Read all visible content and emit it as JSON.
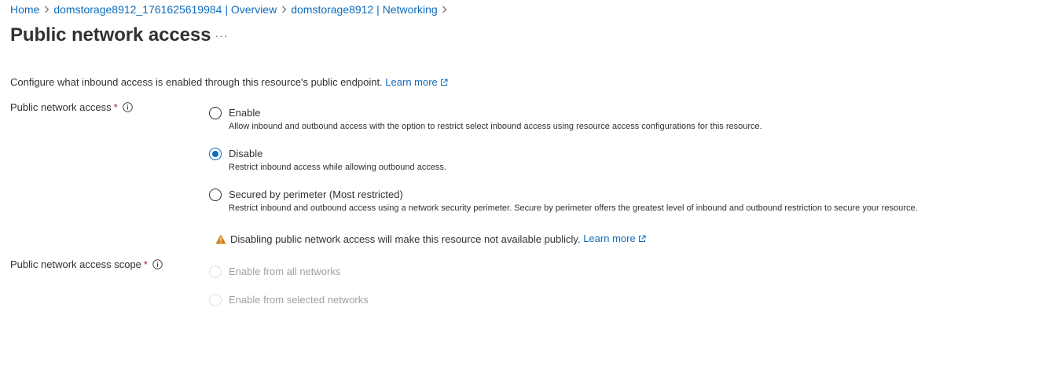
{
  "breadcrumb": {
    "items": [
      "Home",
      "domstorage8912_1761625619984 | Overview",
      "domstorage8912 | Networking"
    ]
  },
  "page": {
    "title": "Public network access",
    "more_label": "···"
  },
  "description": {
    "text": "Configure what inbound access is enabled through this resource's public endpoint.",
    "link": "Learn more"
  },
  "public_network_access": {
    "label": "Public network access",
    "required": "*",
    "options": [
      {
        "label": "Enable",
        "description": "Allow inbound and outbound access with the option to restrict select inbound access using resource access configurations for this resource.",
        "selected": false
      },
      {
        "label": "Disable",
        "description": "Restrict inbound access while allowing outbound access.",
        "selected": true
      },
      {
        "label": "Secured by perimeter (Most restricted)",
        "description": "Restrict inbound and outbound access using a network security perimeter. Secure by perimeter offers the greatest level of inbound and outbound restriction to secure your resource.",
        "selected": false
      }
    ]
  },
  "warning": {
    "text": "Disabling public network access will make this resource not available publicly.",
    "link": "Learn more"
  },
  "scope": {
    "label": "Public network access scope",
    "required": "*",
    "options": [
      {
        "label": "Enable from all networks",
        "disabled": true
      },
      {
        "label": "Enable from selected networks",
        "disabled": true
      }
    ]
  },
  "colors": {
    "link": "#0f6cbd",
    "required": "#a4262c",
    "warning": "#d67f17",
    "disabled": "#a19f9d"
  }
}
